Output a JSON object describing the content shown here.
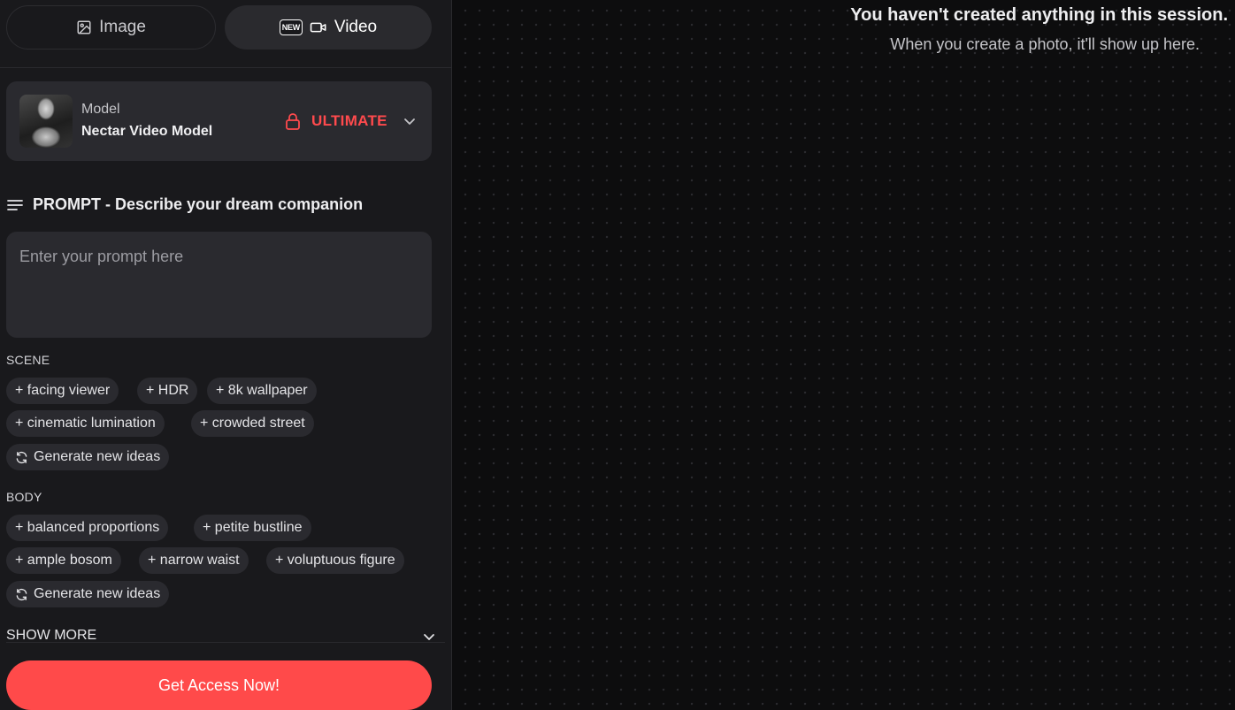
{
  "tabs": {
    "image_label": "Image",
    "video_badge": "NEW",
    "video_label": "Video"
  },
  "model": {
    "label": "Model",
    "name": "Nectar Video Model",
    "tier": "ULTIMATE",
    "tier_color": "#ff4a4d"
  },
  "prompt": {
    "heading": "PROMPT - Describe your dream companion",
    "placeholder": "Enter your prompt here",
    "value": ""
  },
  "scene": {
    "label": "SCENE",
    "chips": [
      "+ facing viewer",
      "+ HDR",
      "+ 8k wallpaper",
      "+ cinematic lumination",
      "+ crowded street"
    ],
    "generate_label": "Generate new ideas"
  },
  "body_section": {
    "label": "BODY",
    "chips": [
      "+ balanced proportions",
      "+ petite bustline",
      "+ ample bosom",
      "+ narrow waist",
      "+ voluptuous figure"
    ],
    "generate_label": "Generate new ideas"
  },
  "show_more_label": "SHOW MORE",
  "cta_label": "Get Access Now!",
  "cta_color": "#ff4a4a",
  "empty_state": {
    "title": "You haven't created anything in this session.",
    "subtitle": "When you create a photo, it'll show up here."
  },
  "icons": {
    "image_tab": "image-icon",
    "video_tab": "video-camera-icon",
    "lock": "lock-icon",
    "chevron": "chevron-down-icon",
    "prompt": "lines-icon",
    "generate": "refresh-icon"
  }
}
